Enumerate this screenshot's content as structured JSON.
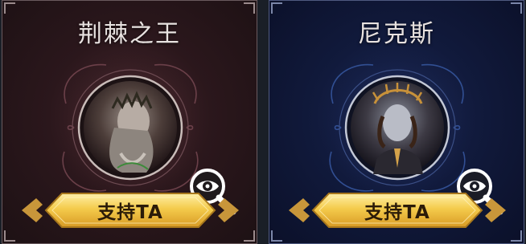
{
  "heroes": [
    {
      "name": "荆棘之王",
      "support_label": "支持TA",
      "theme": {
        "accent": "#3a1e24",
        "ring": "#b8a8a6"
      },
      "portrait_icon": "thorn-king-portrait-icon",
      "view_icon": "magnifier-eye-icon"
    },
    {
      "name": "尼克斯",
      "support_label": "支持TA",
      "theme": {
        "accent": "#142255",
        "ring": "#a7b0c8"
      },
      "portrait_icon": "nyx-portrait-icon",
      "view_icon": "magnifier-eye-icon"
    }
  ],
  "colors": {
    "button_gold": "#f2c94c",
    "button_border": "#a8771c",
    "label_dark": "#2b1b08"
  }
}
